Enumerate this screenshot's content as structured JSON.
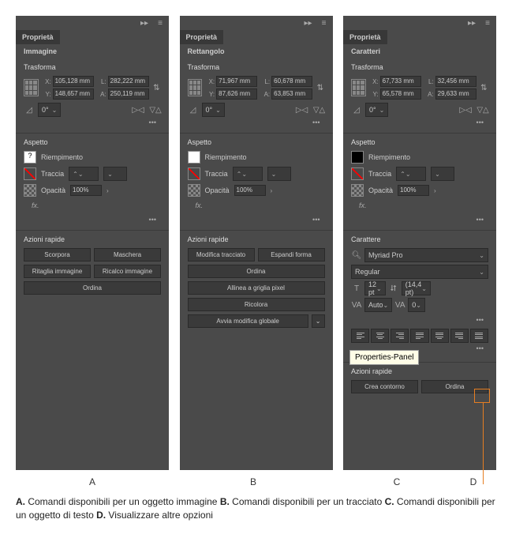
{
  "common": {
    "tab": "Proprietà",
    "transform": "Trasforma",
    "appearance": "Aspetto",
    "fill": "Riempimento",
    "stroke": "Traccia",
    "opacity": "Opacità",
    "opacity_val": "100%",
    "angle": "0°",
    "actions": "Azioni rapide",
    "fx": "fx."
  },
  "panelA": {
    "object": "Immagine",
    "x": "105,128 mm",
    "y": "148,657 mm",
    "w": "282,222 mm",
    "h": "250,119 mm",
    "actions": [
      [
        "Scorpora",
        "Maschera"
      ],
      [
        "Ritaglia immagine",
        "Ricalco immagine"
      ],
      [
        "Ordina"
      ]
    ]
  },
  "panelB": {
    "object": "Rettangolo",
    "x": "71,967 mm",
    "y": "87,626 mm",
    "w": "60,678 mm",
    "h": "63,853 mm",
    "actions": [
      [
        "Modifica tracciato",
        "Espandi forma"
      ],
      [
        "Ordina"
      ],
      [
        "Allinea a griglia pixel"
      ],
      [
        "Ricolora"
      ],
      [
        "Avvia modifica globale"
      ]
    ]
  },
  "panelC": {
    "object": "Caratteri",
    "x": "67,733 mm",
    "y": "65,578 mm",
    "w": "32,456 mm",
    "h": "29,633 mm",
    "character_title": "Carattere",
    "font": "Myriad Pro",
    "style": "Regular",
    "size": "12 pt",
    "leading": "(14,4 pt)",
    "kerning": "Auto",
    "tracking": "0",
    "tooltip": "Properties-Panel",
    "actions": [
      [
        "Crea contorno",
        "Ordina"
      ]
    ]
  },
  "labels": {
    "a": "A",
    "b": "B",
    "c": "C",
    "d": "D"
  },
  "caption": {
    "a_b": "A.",
    "a_t": " Comandi disponibili per un oggetto immagine ",
    "b_b": "B.",
    "b_t": " Comandi disponibili per un tracciato ",
    "c_b": "C.",
    "c_t": " Comandi disponibili per un oggetto di testo ",
    "d_b": "D.",
    "d_t": " Visualizzare altre opzioni"
  }
}
